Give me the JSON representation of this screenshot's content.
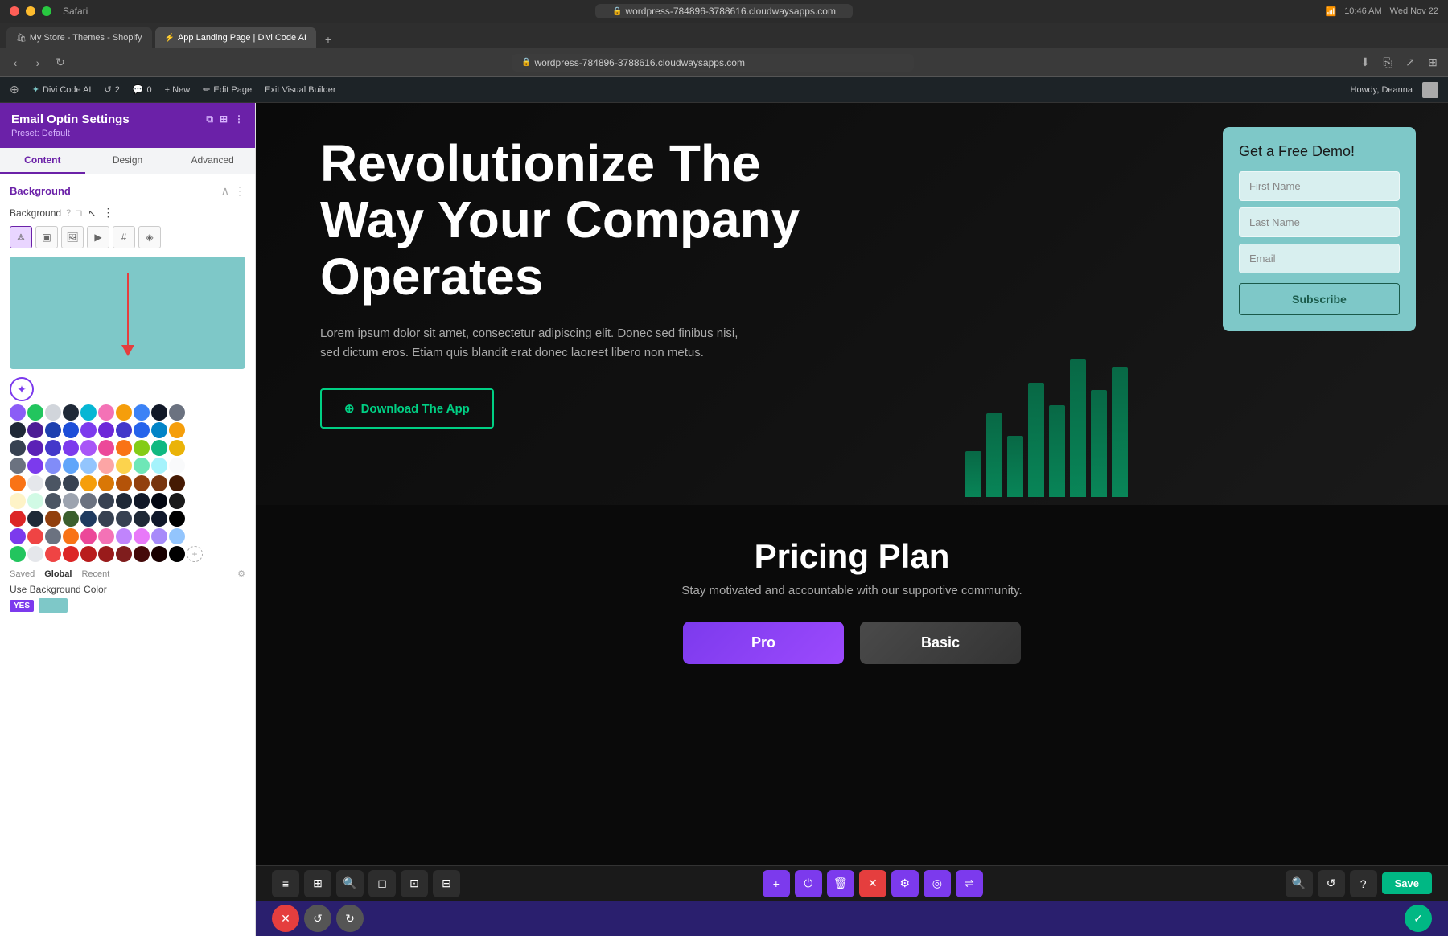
{
  "macos": {
    "browser": "Safari",
    "date": "Wed Nov 22",
    "time": "10:46 AM"
  },
  "browser": {
    "url": "wordpress-784896-3788616.cloudwaysapps.com",
    "tabs": [
      {
        "label": "My Store - Themes - Shopify",
        "active": false
      },
      {
        "label": "App Landing Page | Divi Code AI",
        "active": true
      }
    ],
    "admin_bar_items": [
      {
        "label": "Divi Code AI"
      },
      {
        "label": "2"
      },
      {
        "label": "0"
      },
      {
        "label": "+ New"
      },
      {
        "label": "Edit Page"
      },
      {
        "label": "Exit Visual Builder"
      }
    ],
    "admin_bar_right": "Howdy, Deanna"
  },
  "sidebar": {
    "title": "Email Optin Settings",
    "preset": "Preset: Default",
    "tabs": [
      "Content",
      "Design",
      "Advanced"
    ],
    "active_tab": "Content",
    "sections": {
      "background": {
        "title": "Background",
        "label": "Background",
        "bg_types": [
          "gradient",
          "color",
          "image",
          "video",
          "pattern",
          "mask"
        ],
        "use_bg_label": "Use Background Color",
        "toggle_yes": "YES"
      }
    },
    "palette": {
      "tabs": [
        "Saved",
        "Global",
        "Recent"
      ],
      "active_tab": "Global"
    }
  },
  "hero": {
    "title": "Revolutionize The Way Your Company Operates",
    "description": "Lorem ipsum dolor sit amet, consectetur adipiscing elit. Donec sed finibus nisi, sed dictum eros. Etiam quis blandit erat donec laoreet libero non metus.",
    "cta_label": "Download The App"
  },
  "demo_card": {
    "title": "Get a Free Demo!",
    "first_name_placeholder": "First Name",
    "last_name_placeholder": "Last Name",
    "email_placeholder": "Email",
    "subscribe_label": "Subscribe"
  },
  "pricing": {
    "title": "Pricing Plan",
    "subtitle": "Stay motivated and accountable with our supportive community.",
    "cards": [
      {
        "label": "Pro"
      },
      {
        "label": "Basic"
      }
    ]
  },
  "toolbar": {
    "save_label": "Save"
  },
  "colors": {
    "purple_accent": "#7c3aed",
    "teal_bg": "#7ec8c8",
    "green_btn": "#00d084"
  },
  "palette_rows": [
    [
      "#8b5cf6",
      "#22c55e",
      "#d1d5db",
      "#1f2937",
      "#06b6d4",
      "#f472b6",
      "#f59e0b",
      "#3b82f6",
      "#111827",
      "#6b7280"
    ],
    [
      "#1f2937",
      "#4c1d95",
      "#1e40af",
      "#1d4ed8",
      "#7c3aed",
      "#6d28d9",
      "#4338ca",
      "#2563eb",
      "#0284c7",
      "#f59e0b"
    ],
    [
      "#374151",
      "#5b21b6",
      "#4338ca",
      "#7c3aed",
      "#a855f7",
      "#ec4899",
      "#f97316",
      "#84cc16",
      "#10b981",
      "#eab308"
    ],
    [
      "#6b7280",
      "#7c3aed",
      "#818cf8",
      "#60a5fa",
      "#93c5fd",
      "#fca5a5",
      "#fcd34d",
      "#6ee7b7",
      "#a5f3fc",
      "#f9fafb"
    ],
    [
      "#f97316",
      "#e5e7eb",
      "#4b5563",
      "#374151",
      "#f59e0b",
      "#d97706",
      "#b45309",
      "#92400e",
      "#78350f",
      "#451a03"
    ],
    [
      "#fef3c7",
      "#d1fae5",
      "#4b5563",
      "#9ca3af",
      "#6b7280",
      "#374151",
      "#1f2937",
      "#111827",
      "#030712",
      "#1a1a1a"
    ],
    [
      "#dc2626",
      "#1f2937",
      "#92400e",
      "#3b5f2e",
      "#1e3a5f",
      "#374151",
      "#374151",
      "#1f2937",
      "#0f172a",
      "#000000"
    ],
    [
      "#7c3aed",
      "#ef4444",
      "#6b7280",
      "#f97316",
      "#ec4899",
      "#f472b6",
      "#c084fc",
      "#e879f9",
      "#a78bfa",
      "#93c5fd"
    ],
    [
      "#22c55e",
      "#e5e7eb",
      "#ef4444",
      "#dc2626",
      "#b91c1c",
      "#991b1b",
      "#7f1d1d",
      "#450a0a",
      "#1a0000",
      "#000000"
    ]
  ]
}
